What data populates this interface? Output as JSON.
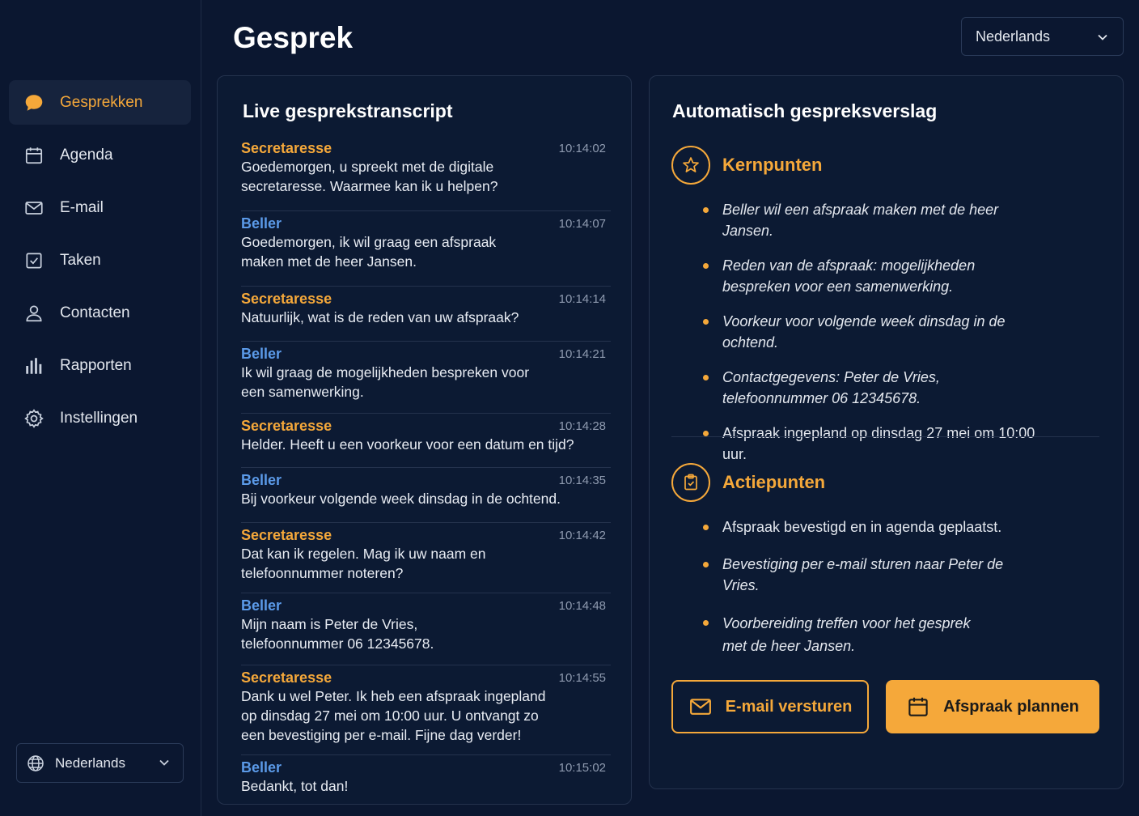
{
  "sidebar": {
    "items": [
      {
        "label": "Gesprekken",
        "icon": "chat-bubble-icon",
        "active": true
      },
      {
        "label": "Agenda",
        "icon": "calendar-icon"
      },
      {
        "label": "E-mail",
        "icon": "mail-icon"
      },
      {
        "label": "Taken",
        "icon": "checkbox-icon"
      },
      {
        "label": "Contacten",
        "icon": "user-icon"
      },
      {
        "label": "Rapporten",
        "icon": "bar-chart-icon"
      },
      {
        "label": "Instellingen",
        "icon": "gear-icon"
      }
    ],
    "language": "Nederlands"
  },
  "header": {
    "title": "Gesprek",
    "language": "Nederlands"
  },
  "transcript": {
    "title": "Live gesprekstranscript",
    "messages": [
      {
        "speaker": "Secretaresse",
        "time": "10:14:02",
        "text": "Goedemorgen, u spreekt met de digitale secretaresse. Waarmee kan ik u helpen?"
      },
      {
        "speaker": "Beller",
        "time": "10:14:07",
        "text": "Goedemorgen, ik wil graag een afspraak maken met de heer Jansen."
      },
      {
        "speaker": "Secretaresse",
        "time": "10:14:14",
        "text": "Natuurlijk, wat is de reden van uw afspraak?"
      },
      {
        "speaker": "Beller",
        "time": "10:14:21",
        "text": "Ik wil graag de mogelijkheden bespreken voor een samenwerking."
      },
      {
        "speaker": "Secretaresse",
        "time": "10:14:28",
        "text": "Helder. Heeft u een voorkeur voor een datum en tijd?"
      },
      {
        "speaker": "Beller",
        "time": "10:14:35",
        "text": "Bij voorkeur volgende week dinsdag in de ochtend."
      },
      {
        "speaker": "Secretaresse",
        "time": "10:14:42",
        "text": "Dat kan ik regelen. Mag ik uw naam en telefoonnummer noteren?"
      },
      {
        "speaker": "Beller",
        "time": "10:14:48",
        "text": "Mijn naam is Peter de Vries, telefoonnummer 06 12345678."
      },
      {
        "speaker": "Secretaresse",
        "time": "10:14:55",
        "text": "Dank u wel Peter. Ik heb een afspraak ingepland op dinsdag 27 mei om 10:00 uur. U ontvangt zo een bevestiging per e-mail. Fijne dag verder!"
      },
      {
        "speaker": "Beller",
        "time": "10:15:02",
        "text": "Bedankt, tot dan!"
      }
    ]
  },
  "report": {
    "title": "Automatisch gespreksverslag",
    "kernpunten": {
      "label": "Kernpunten",
      "items": [
        "Beller wil een afspraak maken met de heer Jansen.",
        "Reden van de afspraak: mogelijkheden bespreken voor een samenwerking.",
        "Voorkeur voor volgende week dinsdag in de ochtend.",
        "Contactgegevens: Peter de Vries, telefoonnummer 06 12345678.",
        "Afspraak ingepland op dinsdag 27 mei om 10:00 uur."
      ]
    },
    "actiepunten": {
      "label": "Actiepunten",
      "items": [
        "Afspraak bevestigd en in agenda geplaatst.",
        "Bevestiging per e-mail sturen naar Peter de Vries.",
        "Voorbereiding treffen voor het gesprek met de heer Jansen."
      ]
    },
    "email_button": "E-mail versturen",
    "plan_button": "Afspraak plannen"
  },
  "colors": {
    "background": "#0b1730",
    "accent": "#f5a83a",
    "secondary_speaker": "#5b9ae8"
  }
}
